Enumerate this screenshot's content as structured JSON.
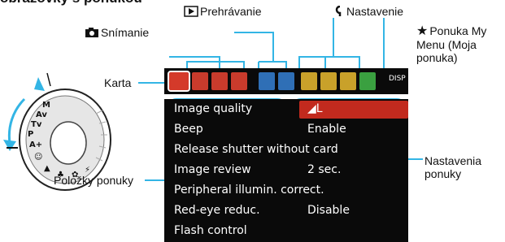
{
  "labels": {
    "title": "obrazovky s ponukou",
    "playback": "Prehrávanie",
    "setup": "Nastavenie",
    "shooting": "Snímanie",
    "mymenu_1": "Ponuka My",
    "mymenu_2": "Menu (Moja",
    "mymenu_3": "ponuka)",
    "tab": "Karta",
    "menu_items": "Položky ponuky",
    "settings_1": "Nastavenia",
    "settings_2": "ponuky"
  },
  "tabs": [
    {
      "name": "tab-shooting-1",
      "color": "#d43a2a",
      "selected": true
    },
    {
      "name": "tab-shooting-2",
      "color": "#c93b2c"
    },
    {
      "name": "tab-shooting-3",
      "color": "#c93b2c"
    },
    {
      "name": "tab-shooting-4",
      "color": "#c93b2c"
    },
    {
      "name": "tab-playback-1",
      "color": "#2f6fb6"
    },
    {
      "name": "tab-playback-2",
      "color": "#2f6fb6"
    },
    {
      "name": "tab-setup-1",
      "color": "#c9a12a"
    },
    {
      "name": "tab-setup-2",
      "color": "#c9a12a"
    },
    {
      "name": "tab-setup-3",
      "color": "#c9a12a"
    },
    {
      "name": "tab-mymenu",
      "color": "#3aa040"
    }
  ],
  "menu": {
    "disp": "DISP",
    "rows": [
      {
        "item": "Image quality",
        "value": "◢L",
        "selected": true
      },
      {
        "item": "Beep",
        "value": "Enable"
      },
      {
        "item": "Release shutter without card",
        "value": ""
      },
      {
        "item": "Image review",
        "value": "2 sec."
      },
      {
        "item": "Peripheral illumin. correct.",
        "value": ""
      },
      {
        "item": "Red-eye reduc.",
        "value": "Disable"
      },
      {
        "item": "Flash control",
        "value": ""
      }
    ]
  },
  "colors": {
    "callout": "#33b5e5",
    "menu_bg": "#0a0a0a",
    "highlight": "#c22a1e"
  },
  "icons": {
    "playback": "play-icon",
    "setup": "wrench-icon",
    "shooting": "camera-icon",
    "mymenu": "star-icon"
  }
}
